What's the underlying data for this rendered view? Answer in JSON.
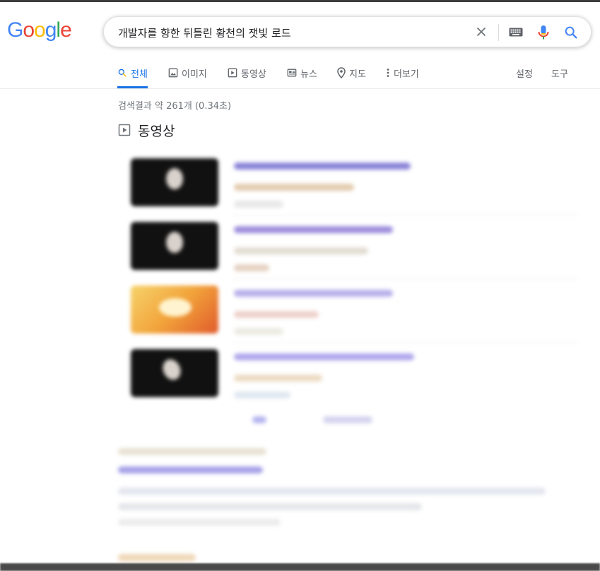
{
  "logo": {
    "letters": [
      "G",
      "o",
      "o",
      "g",
      "l",
      "e"
    ],
    "colors": [
      "#4285F4",
      "#EA4335",
      "#FBBC05",
      "#4285F4",
      "#34A853",
      "#EA4335"
    ]
  },
  "search": {
    "query": "개발자를 향한 뒤틀린 황천의 잿빛 로드"
  },
  "tabs": [
    {
      "label": "전체",
      "icon": "search-icon",
      "active": true
    },
    {
      "label": "이미지",
      "icon": "image-icon"
    },
    {
      "label": "동영상",
      "icon": "play-icon"
    },
    {
      "label": "뉴스",
      "icon": "news-icon"
    },
    {
      "label": "지도",
      "icon": "map-pin-icon"
    },
    {
      "label": "더보기",
      "icon": "more-vert-icon"
    }
  ],
  "tools": {
    "settings": "설정",
    "tools": "도구"
  },
  "results": {
    "stats": "검색결과 약 261개 (0.34초)"
  },
  "videos": {
    "heading": "동영상",
    "icon": "play-icon"
  },
  "colors": {
    "accent": "#1a73e8",
    "link": "#1a0dab",
    "mic_red": "#ea4335",
    "mic_blue": "#4285f4"
  }
}
